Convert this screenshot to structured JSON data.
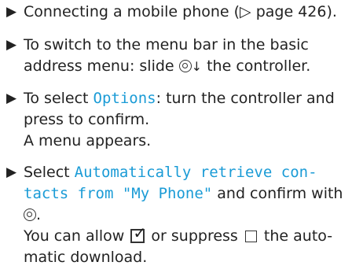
{
  "steps": [
    {
      "lines": [
        "Connecting a mobile phone (▷ page 426)."
      ]
    },
    {
      "line1": "To switch to the menu bar in the basic",
      "line2_a": "address menu: slide ",
      "line2_b": "↓",
      "line2_c": " the controller."
    },
    {
      "line1_a": "To select ",
      "line1_mono": "Options",
      "line1_b": ": turn the controller and",
      "line2": "press to confirm.",
      "line3": "A menu appears."
    },
    {
      "line1_a": "Select ",
      "line1_mono": "Automatically retrieve con-",
      "line2_mono": "tacts from \"My Phone\"",
      "line2_b": " and confirm with",
      "line3": ".",
      "line4_a": "You can allow ",
      "line4_b": " or suppress ",
      "line4_c": " the auto-",
      "line5": "matic download."
    }
  ],
  "arrow_glyph": "▶"
}
